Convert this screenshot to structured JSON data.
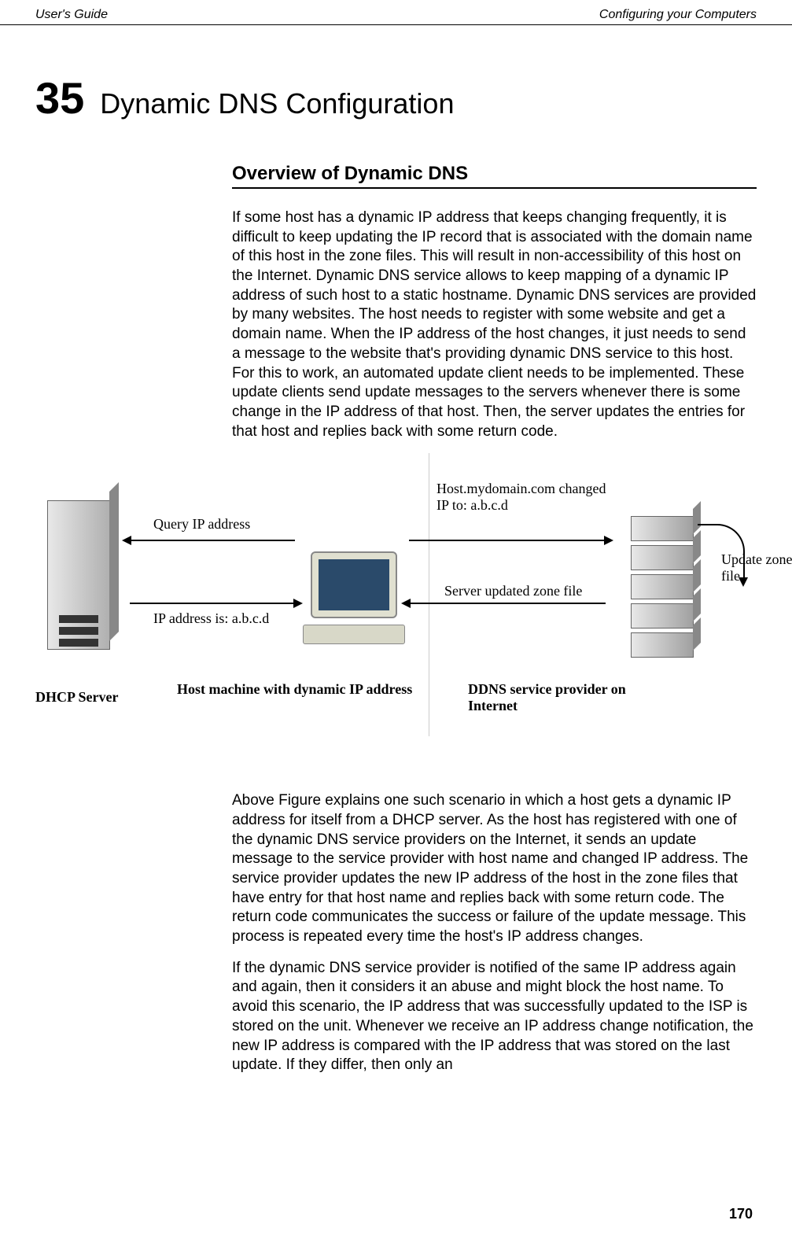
{
  "header": {
    "left": "User's Guide",
    "right": "Configuring your Computers"
  },
  "chapter": {
    "number": "35",
    "title": "Dynamic DNS Configuration"
  },
  "section_heading": "Overview of Dynamic DNS",
  "paragraphs": {
    "p1": "If some host has a dynamic IP address that keeps changing frequently, it is difficult to keep updating the IP record that is associated with the domain name of this host in the zone files. This will result in non-accessibility of this host on the Internet. Dynamic DNS service allows to keep mapping of a dynamic IP address of such host to a static hostname. Dynamic DNS services are provided by many websites. The host needs to register with some website and get a domain name. When the IP address of the host changes, it just needs to send a message to the website that's providing dynamic DNS service to this host. For this to work, an automated update client needs to be implemented. These update clients send update messages to the servers whenever there is some change in the IP address of that host. Then, the server updates the entries for that host and replies back with some return code.",
    "p2": "Above Figure explains one such scenario in which a host gets a dynamic IP address for itself from a DHCP server. As the host has registered with one of the dynamic DNS service providers on the Internet, it sends an update message to the service provider with host name and changed IP address. The service provider updates the new IP address of the host in the zone files that have entry for that host name and replies back with some return code. The return code communicates the success or failure of the update message. This process is repeated every time the host's IP address changes.",
    "p3": "If the dynamic DNS service provider is notified of the same IP address again and again, then it considers it an abuse and might block the host name. To avoid this scenario, the IP address that was successfully updated to the ISP is stored on the unit. Whenever we receive an IP address change notification, the new IP address is compared with the IP address that was stored on the last update. If they differ, then only an"
  },
  "figure": {
    "query_label": "Query IP address",
    "ip_label": "IP address is: a.b.c.d",
    "changed_label": "Host.mydomain.com changed IP to: a.b.c.d",
    "server_updated": "Server updated zone file",
    "update_zone": "Update zone file",
    "dhcp_caption": "DHCP Server",
    "host_caption": "Host machine with dynamic IP address",
    "ddns_caption": "DDNS service provider on Internet"
  },
  "page_number": "170"
}
